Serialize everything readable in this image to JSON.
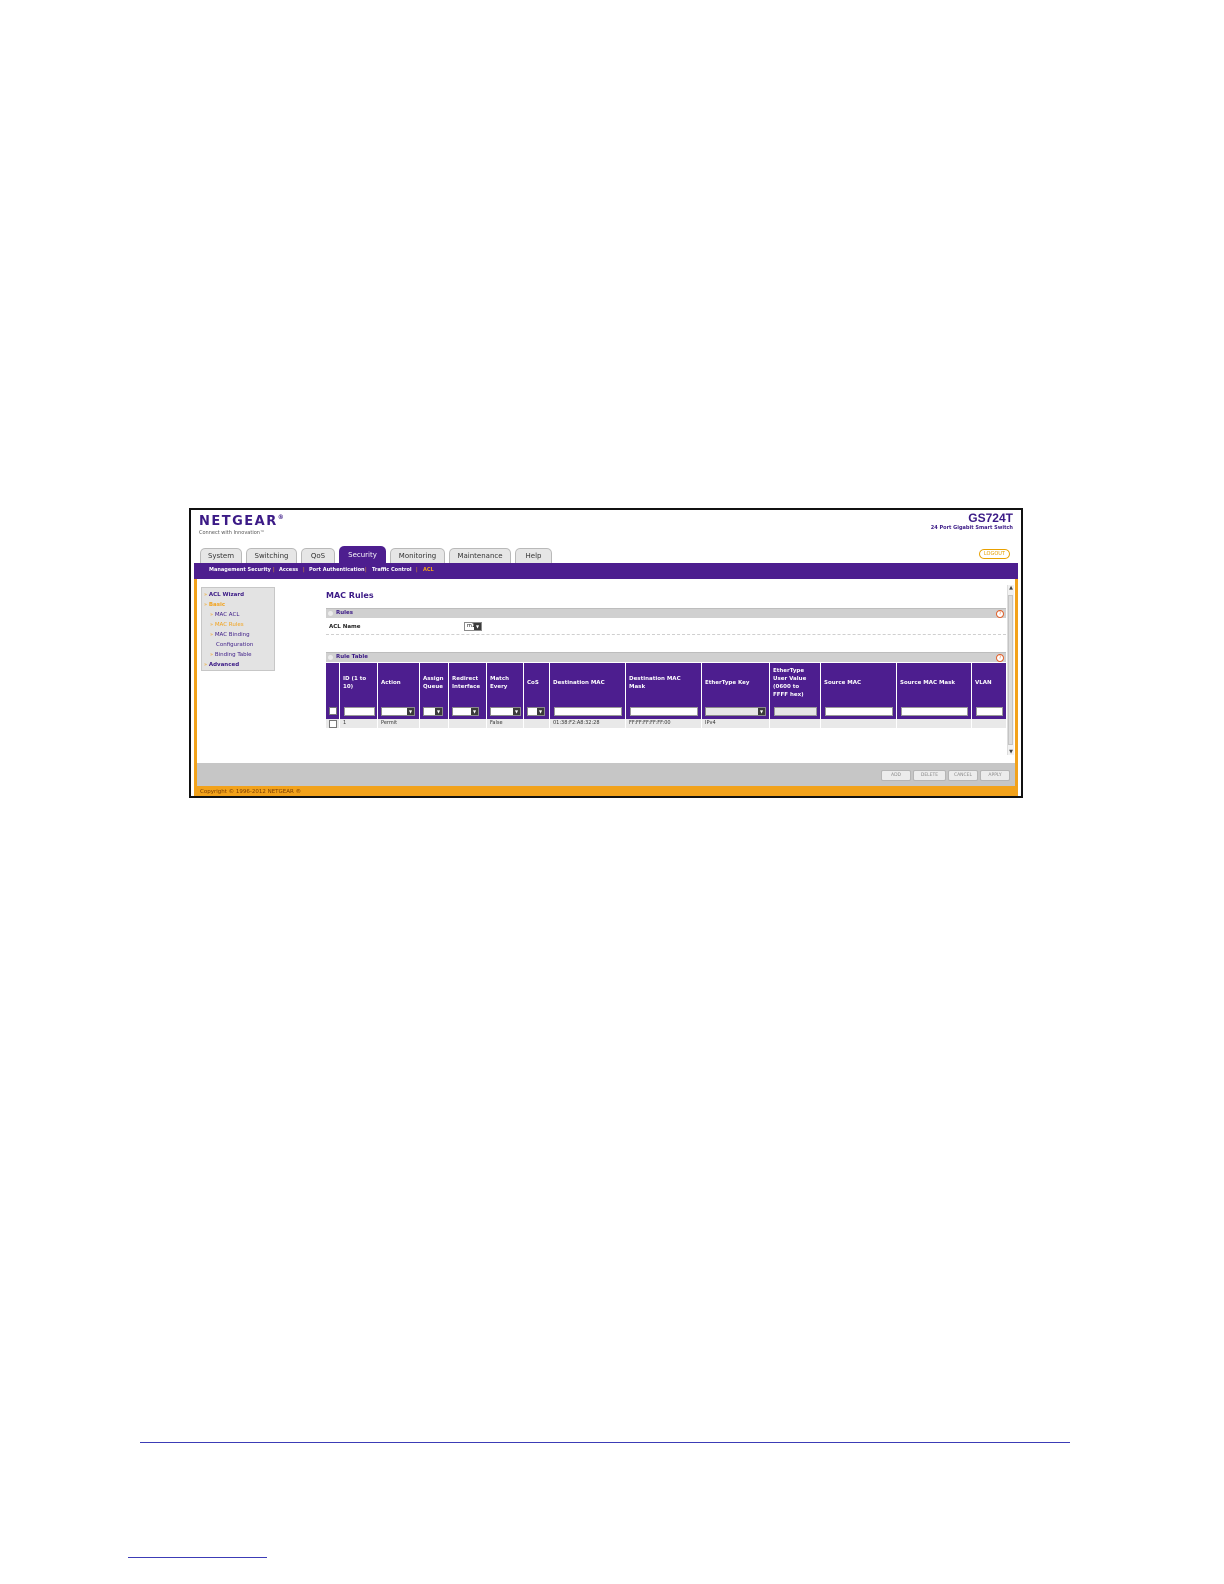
{
  "header": {
    "brand": "NETGEAR",
    "trademark": "®",
    "tagline": "Connect with Innovation™",
    "model": "GS724T",
    "model_desc": "24 Port Gigabit Smart Switch",
    "logout": "LOGOUT"
  },
  "tabs": [
    {
      "label": "System"
    },
    {
      "label": "Switching"
    },
    {
      "label": "QoS"
    },
    {
      "label": "Security"
    },
    {
      "label": "Monitoring"
    },
    {
      "label": "Maintenance"
    },
    {
      "label": "Help"
    }
  ],
  "active_tab": "Security",
  "subnav": [
    {
      "label": "Management Security"
    },
    {
      "label": "Access"
    },
    {
      "label": "Port Authentication"
    },
    {
      "label": "Traffic Control"
    },
    {
      "label": "ACL"
    }
  ],
  "sidebar": {
    "acl_wizard": "ACL Wizard",
    "basic": "Basic",
    "mac_acl": "MAC ACL",
    "mac_rules": "MAC Rules",
    "mac_binding_1": "MAC Binding",
    "mac_binding_2": "Configuration",
    "binding_table": "Binding Table",
    "advanced": "Advanced",
    "bullet": "»"
  },
  "page": {
    "title": "MAC Rules",
    "rules_section": "Rules",
    "acl_name_label": "ACL Name",
    "acl_name_value": "m1",
    "rule_table_section": "Rule Table",
    "help_glyph": "?"
  },
  "table": {
    "columns": [
      "",
      "ID (1 to\n10)",
      "Action",
      "Assign\nQueue",
      "Redirect\nInterface",
      "Match\nEvery",
      "CoS",
      "Destination MAC",
      "Destination MAC\nMask",
      "EtherType Key",
      "EtherType\nUser Value\n(0600 to\nFFFF hex)",
      "Source MAC",
      "Source MAC Mask",
      "VLAN"
    ],
    "rows": [
      [
        "",
        "1",
        "Permit",
        "",
        "",
        "False",
        "",
        "01:38:F2:A8:32:28",
        "FF:FF:FF:FF:FF:00",
        "IPv4",
        "",
        "",
        "",
        ""
      ]
    ]
  },
  "buttons": {
    "add": "ADD",
    "delete": "DELETE",
    "cancel": "CANCEL",
    "apply": "APPLY"
  },
  "footer": {
    "copyright": "Copyright © 1996-2012 NETGEAR ®"
  },
  "colors": {
    "brand_purple": "#4d1e8f",
    "accent_orange": "#f2a21b"
  }
}
